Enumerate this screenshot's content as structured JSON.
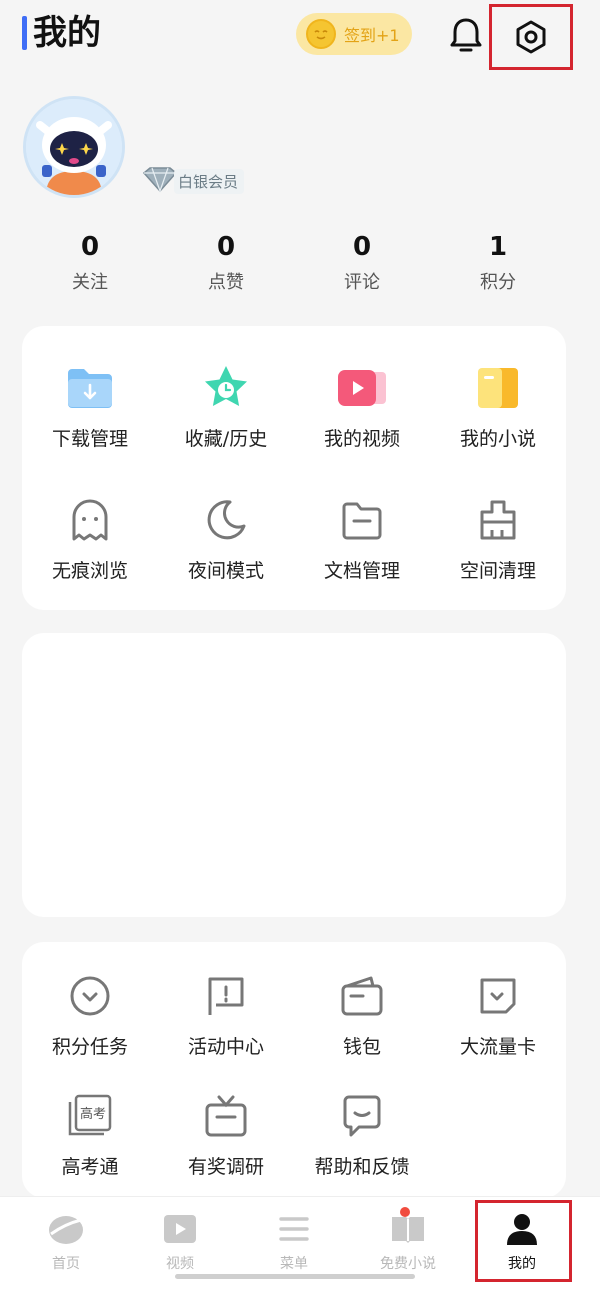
{
  "header": {
    "title": "我的",
    "checkin_label": "签到+1"
  },
  "profile": {
    "member_label": "白银会员"
  },
  "stats": [
    {
      "value": "0",
      "label": "关注"
    },
    {
      "value": "0",
      "label": "点赞"
    },
    {
      "value": "0",
      "label": "评论"
    },
    {
      "value": "1",
      "label": "积分"
    }
  ],
  "tools": [
    {
      "label": "下载管理",
      "icon": "download-folder-icon"
    },
    {
      "label": "收藏/历史",
      "icon": "star-clock-icon"
    },
    {
      "label": "我的视频",
      "icon": "video-icon"
    },
    {
      "label": "我的小说",
      "icon": "book-icon"
    },
    {
      "label": "无痕浏览",
      "icon": "ghost-icon"
    },
    {
      "label": "夜间模式",
      "icon": "moon-icon"
    },
    {
      "label": "文档管理",
      "icon": "folder-icon"
    },
    {
      "label": "空间清理",
      "icon": "broom-icon"
    }
  ],
  "services": [
    {
      "label": "积分任务",
      "icon": "points-task-icon"
    },
    {
      "label": "活动中心",
      "icon": "flag-icon"
    },
    {
      "label": "钱包",
      "icon": "wallet-icon"
    },
    {
      "label": "大流量卡",
      "icon": "sim-card-icon"
    },
    {
      "label": "高考通",
      "icon": "gaokao-icon",
      "icon_text": "高考"
    },
    {
      "label": "有奖调研",
      "icon": "tv-gift-icon"
    },
    {
      "label": "帮助和反馈",
      "icon": "chat-icon"
    }
  ],
  "tabbar": {
    "items": [
      {
        "label": "首页",
        "icon": "home-icon"
      },
      {
        "label": "视频",
        "icon": "play-icon"
      },
      {
        "label": "菜单",
        "icon": "menu-icon"
      },
      {
        "label": "免费小说",
        "icon": "open-book-icon"
      },
      {
        "label": "我的",
        "icon": "person-icon"
      }
    ],
    "active": "我的"
  },
  "colors": {
    "accent": "#3f6df6",
    "highlight": "#d4252f",
    "checkin_bg": "#fbe7a3",
    "checkin_text": "#e3a316"
  }
}
